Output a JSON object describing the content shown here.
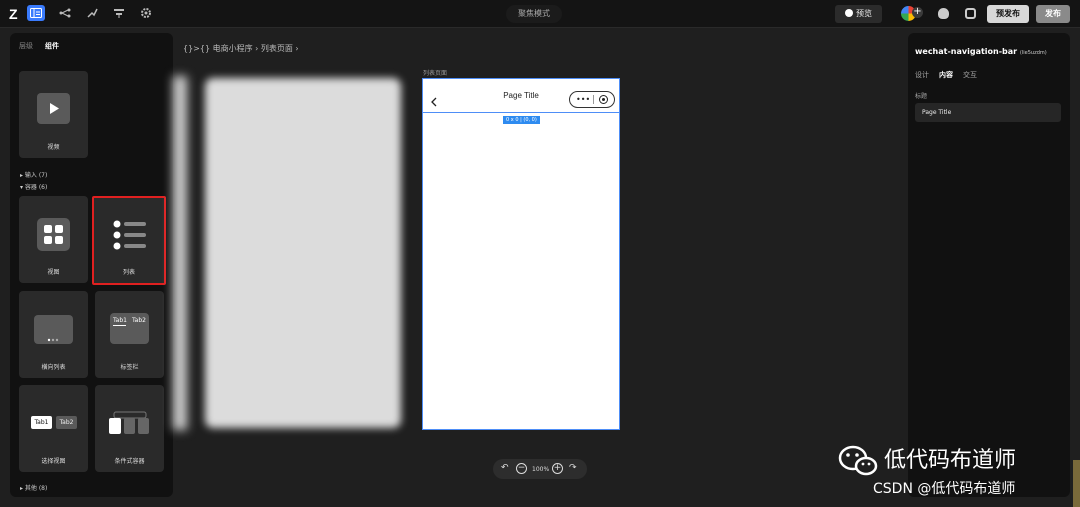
{
  "topbar": {
    "logo": "Z",
    "mode_label": "聚焦模式",
    "preview_label": "预览",
    "prepublish_label": "预发布",
    "publish_label": "发布"
  },
  "left_panel": {
    "tabs": [
      "层级",
      "组件"
    ],
    "video_label": "视频",
    "section_input": "输入 (7)",
    "section_container": "容器 (6)",
    "view_label": "视图",
    "list_label": "列表",
    "hscroll_label": "横向列表",
    "tabbar_label": "标签栏",
    "tabbar_tab1": "Tab1",
    "tabbar_tab2": "Tab2",
    "swiper_label": "选择视图",
    "swiper_tab1": "Tab1",
    "swiper_tab2": "Tab2",
    "cond_label": "条件式容器",
    "section_other": "其他 (8)"
  },
  "breadcrumb": "{}>{} 电商小程序 › 列表页面 ›",
  "canvas": {
    "page_label": "列表页面",
    "nav_title": "Page Title",
    "dim_tag": "0 x 0 | (0, 0)"
  },
  "zoom": {
    "level": "100%"
  },
  "right_panel": {
    "component_name": "wechat-navigation-bar",
    "component_id": "(lie5uzdm)",
    "tabs": [
      "设计",
      "内容",
      "交互"
    ],
    "field_label": "标题",
    "field_value": "Page Title"
  },
  "watermark": {
    "line1": "低代码布道师",
    "line2": "CSDN @低代码布道师"
  },
  "colors": {
    "accent": "#3a7bfd",
    "highlight": "#e02020"
  }
}
